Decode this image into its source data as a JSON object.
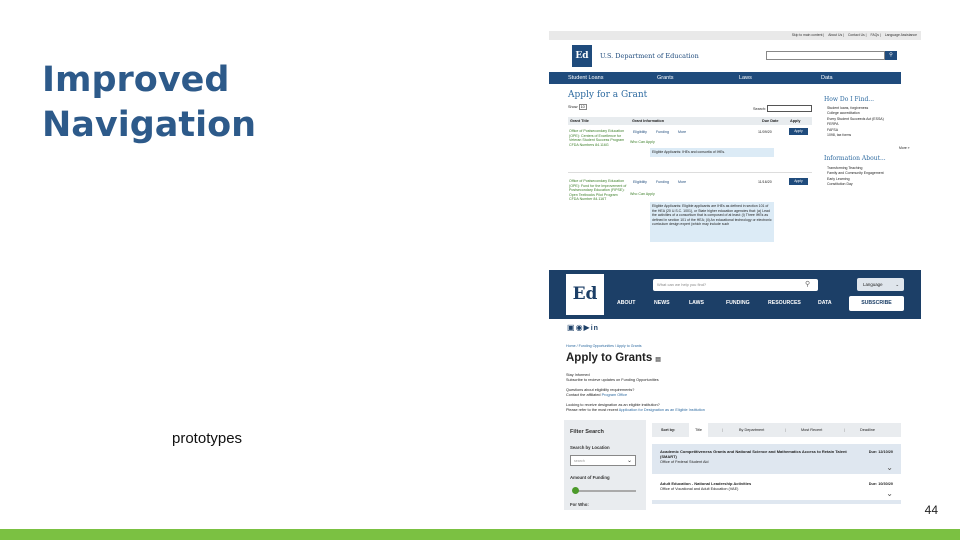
{
  "slide": {
    "title_lines": [
      "Improved",
      "Navigation"
    ],
    "caption": "prototypes",
    "page_number": "44",
    "accent_color": "#7bc142",
    "title_color": "#2d5a8a"
  },
  "shot1": {
    "utility_links": [
      "Skip to main content",
      "About Us",
      "Contact Us",
      "FAQs",
      "Language Assistance"
    ],
    "logo_text": "Ed",
    "brand": "U.S. Department of Education",
    "search_button_icon": "search-icon",
    "nav": [
      "Student Loans",
      "Grants",
      "Laws",
      "Data"
    ],
    "page_title": "Apply for a Grant",
    "show_label": "Show",
    "show_value": "10",
    "search_label": "Search:",
    "table_headers": {
      "title": "Grant Title",
      "info": "Grant Information",
      "due": "Due Date",
      "apply": "Apply"
    },
    "rows": [
      {
        "title": "Office of Postsecondary Education (OPE): Centers of Excellence for Veteran Student Success Program CFDA Numbers 84.116G",
        "tabs": [
          "Eligibility",
          "Funding",
          "More"
        ],
        "due": "11/09/20",
        "apply": "Apply",
        "who": "Who Can Apply",
        "eligible": "Eligible Applicants: IHEs and consortia of IHEs."
      },
      {
        "title": "Office of Postsecondary Education (OPE): Fund for the Improvement of Postsecondary Education (FIPSE): Open Textbooks Pilot Program CFDA Number 84.116T",
        "tabs": [
          "Eligibility",
          "Funding",
          "More"
        ],
        "due": "11/16/20",
        "apply": "Apply",
        "who": "Who Can Apply",
        "eligible": "Eligible Applicants: Eligible applicants are IHEs as defined in section 101 of the HEA (20 U.S.C. 1001), or State higher education agencies that: (a) Lead the activities of a consortium that is composed of at least: (i) Three IHEs as defined in section 101 of the HEA; (ii) An educational technology or electronic curriculum design expert (which may include such"
      }
    ],
    "sidebar_title_1": "How Do I Find...",
    "find_links": [
      "Student loans, forgiveness",
      "College accreditation",
      "Every Student Succeeds Act (ESSA)",
      "FERPA",
      "FAFSA",
      "1098, tax forms"
    ],
    "more_label": "More »",
    "sidebar_title_2": "Information About...",
    "info_links": [
      "Transforming Teaching",
      "Family and Community Engagement",
      "Early Learning",
      "Constitution Day"
    ]
  },
  "shot2": {
    "logo_text": "Ed",
    "search_placeholder": "What can we help you find?",
    "language": "Language",
    "nav": [
      "ABOUT",
      "NEWS",
      "LAWS",
      "FUNDING",
      "RESOURCES",
      "DATA"
    ],
    "subscribe": "SUBSCRIBE",
    "social_icons": [
      "instagram-icon",
      "facebook-icon",
      "youtube-icon",
      "linkedin-icon"
    ],
    "breadcrumb": "Home  /  Funding Opportunities  /  Apply to Grants",
    "page_title": "Apply to Grants",
    "stay_informed_1": "Stay Informed",
    "stay_informed_2": "Subscribe to recieve updates on Funding Opportunities",
    "questions_1": "Questions about eligibility requirements?",
    "questions_2_prefix": "Contact the affiliated",
    "questions_2_link": "Program Office",
    "designation_1": "Looking to receive designation as an eligible institution?",
    "designation_2_prefix": "Please refer to the most recent",
    "designation_2_link": "Application for Designation as an Eligible Institution",
    "filter_title": "Filter Search",
    "location_label": "Search by Location",
    "location_placeholder": "search",
    "funding_label": "Amount of Funding",
    "funding_level": 0,
    "for_who_label": "For Who:",
    "sort_label": "Sort by:",
    "sort_options": [
      "Title",
      "By Department",
      "Most Recent",
      "Deadline"
    ],
    "sort_selected": "Title",
    "cards": [
      {
        "title": "Academic Competitiveness Grants and National Science and Mathematics Access to Retain Talent (SMART)",
        "office": "Office of Federal Student Aid",
        "due": "Due: 12/10/20"
      },
      {
        "title": "Adult Education - National Leadership Activities",
        "office": "Office of Vocational and Adult Education (VAE)",
        "due": "Due: 10/30/20"
      }
    ]
  }
}
